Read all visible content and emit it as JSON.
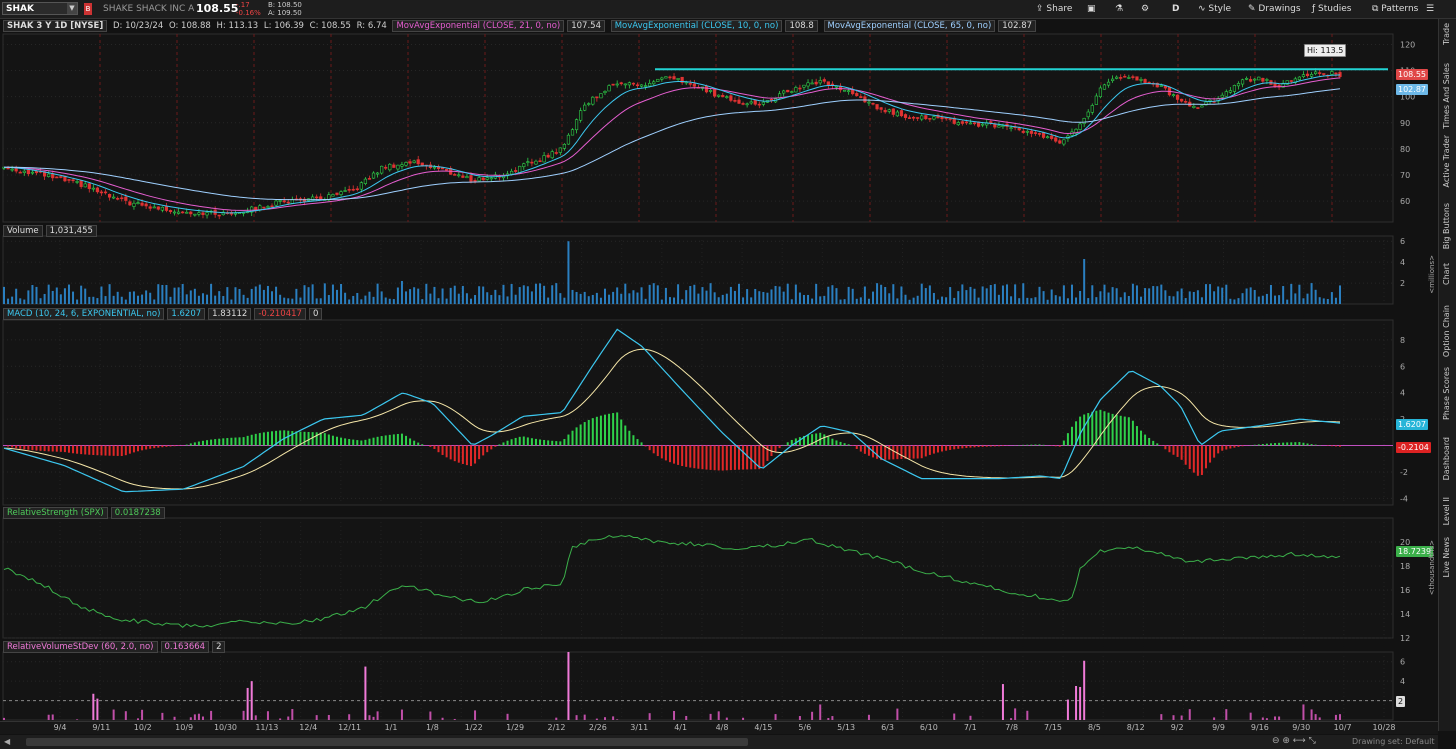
{
  "toolbar": {
    "symbol": "SHAK",
    "company": "SHAKE SHACK INC A",
    "last": "108.55",
    "change": "-.17",
    "change_pct": "-0.16%",
    "bid": "B: 108.50",
    "ask": "A: 109.50",
    "share": "Share",
    "timeframe": "D",
    "style": "Style",
    "drawings": "Drawings",
    "studies": "Studies",
    "patterns": "Patterns"
  },
  "header": {
    "title": "SHAK 3 Y 1D [NYSE]",
    "date": "D: 10/23/24",
    "open": "O: 108.88",
    "high": "H: 113.13",
    "low": "L: 106.39",
    "close": "C: 108.55",
    "range": "R: 6.74",
    "ema21": "MovAvgExponential (CLOSE, 21, 0, no)",
    "ema21_val": "107.54",
    "ema10": "MovAvgExponential (CLOSE, 10, 0, no)",
    "ema10_val": "108.8",
    "ema65": "MovAvgExponential (CLOSE, 65, 0, no)",
    "ema65_val": "102.87"
  },
  "volume": {
    "label": "Volume",
    "value": "1,031,455",
    "unit": "<millions>"
  },
  "macd": {
    "label": "MACD (10, 24, 6, EXPONENTIAL, no)",
    "v1": "1.6207",
    "v2": "1.83112",
    "v3": "-0.210417",
    "v4": "0"
  },
  "rs": {
    "label": "RelativeStrength (SPX)",
    "value": "0.0187238",
    "unit": "<thousandths>"
  },
  "rvol": {
    "label": "RelativeVolumeStDev (60, 2.0, no)",
    "value": "0.163664",
    "v2": "2"
  },
  "price_labels": {
    "hi": "Hi: 113.5",
    "last": "108.55",
    "ema65": "102.87",
    "macd": "1.6207",
    "macd_hist": "-0.2104",
    "rs": "18.7239",
    "rvol": "2"
  },
  "side_tabs": [
    "Trade",
    "Times And Sales",
    "Active Trader",
    "Big Buttons",
    "Chart",
    "Option Chain",
    "Phase Scores",
    "Dashboard",
    "Level II",
    "Live News"
  ],
  "footer": {
    "drawing_set": "Drawing set: Default"
  },
  "chart_data": {
    "type": "candlestick",
    "price_axis": {
      "ticks": [
        60,
        70,
        80,
        90,
        100,
        110,
        120
      ],
      "ylim": [
        52,
        124
      ]
    },
    "volume_axis": {
      "ticks": [
        2,
        4,
        6
      ],
      "ylim": [
        0,
        6.5
      ]
    },
    "macd_axis": {
      "ticks": [
        -4,
        -2,
        2,
        4,
        6,
        8
      ],
      "ylim": [
        -4.5,
        9.5
      ]
    },
    "rs_axis": {
      "ticks": [
        12,
        14,
        16,
        18,
        20
      ],
      "ylim": [
        12,
        22
      ]
    },
    "rvol_axis": {
      "ticks": [
        2,
        4,
        6
      ],
      "ylim": [
        0,
        7
      ]
    },
    "x_ticks": [
      "9/4",
      "9/11",
      "10/2",
      "10/9",
      "10/30",
      "11/13",
      "12/4",
      "12/11",
      "1/1",
      "1/8",
      "1/22",
      "1/29",
      "2/12",
      "2/26",
      "3/11",
      "4/1",
      "4/8",
      "4/15",
      "5/6",
      "5/13",
      "6/3",
      "6/10",
      "7/1",
      "7/8",
      "7/15",
      "8/5",
      "8/12",
      "9/2",
      "9/9",
      "9/16",
      "9/30",
      "10/7",
      "10/28"
    ],
    "close_path": [
      [
        0,
        73
      ],
      [
        40,
        70
      ],
      [
        80,
        66
      ],
      [
        110,
        61
      ],
      [
        140,
        58
      ],
      [
        180,
        56
      ],
      [
        220,
        55
      ],
      [
        250,
        57
      ],
      [
        280,
        60
      ],
      [
        320,
        61
      ],
      [
        350,
        64
      ],
      [
        380,
        73
      ],
      [
        410,
        75
      ],
      [
        440,
        72
      ],
      [
        470,
        68
      ],
      [
        500,
        70
      ],
      [
        530,
        75
      ],
      [
        560,
        80
      ],
      [
        580,
        96
      ],
      [
        600,
        102
      ],
      [
        620,
        106
      ],
      [
        640,
        104
      ],
      [
        660,
        107
      ],
      [
        680,
        106
      ],
      [
        700,
        103
      ],
      [
        720,
        100
      ],
      [
        740,
        98
      ],
      [
        760,
        97
      ],
      [
        780,
        101
      ],
      [
        800,
        104
      ],
      [
        820,
        106
      ],
      [
        840,
        103
      ],
      [
        860,
        99
      ],
      [
        880,
        95
      ],
      [
        900,
        93
      ],
      [
        930,
        92
      ],
      [
        960,
        90
      ],
      [
        990,
        89
      ],
      [
        1020,
        87
      ],
      [
        1040,
        85
      ],
      [
        1060,
        82
      ],
      [
        1080,
        90
      ],
      [
        1100,
        103
      ],
      [
        1120,
        108
      ],
      [
        1140,
        106
      ],
      [
        1160,
        104
      ],
      [
        1180,
        98
      ],
      [
        1200,
        96
      ],
      [
        1220,
        100
      ],
      [
        1240,
        106
      ],
      [
        1260,
        107
      ],
      [
        1280,
        104
      ],
      [
        1300,
        108
      ],
      [
        1320,
        109
      ],
      [
        1340,
        108.55
      ]
    ],
    "resistance": 110.5,
    "macd_line": [
      [
        0,
        -0.2
      ],
      [
        60,
        -1.5
      ],
      [
        120,
        -3.5
      ],
      [
        180,
        -3.3
      ],
      [
        240,
        -1.6
      ],
      [
        280,
        0.5
      ],
      [
        320,
        2
      ],
      [
        360,
        2.3
      ],
      [
        400,
        4
      ],
      [
        430,
        3.2
      ],
      [
        470,
        0
      ],
      [
        490,
        0.8
      ],
      [
        520,
        2.2
      ],
      [
        560,
        2.5
      ],
      [
        590,
        6
      ],
      [
        615,
        8.8
      ],
      [
        640,
        7.5
      ],
      [
        680,
        4.2
      ],
      [
        720,
        1
      ],
      [
        760,
        -1.8
      ],
      [
        790,
        0
      ],
      [
        820,
        1.5
      ],
      [
        850,
        1
      ],
      [
        880,
        -1
      ],
      [
        920,
        -2.5
      ],
      [
        960,
        -2.5
      ],
      [
        1000,
        -2.5
      ],
      [
        1040,
        -2.3
      ],
      [
        1060,
        -2.5
      ],
      [
        1080,
        1
      ],
      [
        1100,
        3.5
      ],
      [
        1130,
        5.7
      ],
      [
        1160,
        4.5
      ],
      [
        1180,
        3
      ],
      [
        1200,
        0
      ],
      [
        1220,
        1.1
      ],
      [
        1260,
        1.5
      ],
      [
        1300,
        2
      ],
      [
        1340,
        1.7
      ]
    ],
    "rs_line": [
      [
        0,
        17.8
      ],
      [
        40,
        16.4
      ],
      [
        80,
        14.5
      ],
      [
        120,
        13.5
      ],
      [
        160,
        13.2
      ],
      [
        200,
        12.9
      ],
      [
        240,
        13.4
      ],
      [
        280,
        13.2
      ],
      [
        320,
        13.6
      ],
      [
        360,
        14.5
      ],
      [
        400,
        16.5
      ],
      [
        440,
        15.5
      ],
      [
        480,
        15
      ],
      [
        520,
        16
      ],
      [
        560,
        16.5
      ],
      [
        570,
        19.6
      ],
      [
        600,
        20.4
      ],
      [
        620,
        20.5
      ],
      [
        660,
        20
      ],
      [
        700,
        19.8
      ],
      [
        740,
        19.4
      ],
      [
        780,
        19.8
      ],
      [
        810,
        20.2
      ],
      [
        840,
        19.4
      ],
      [
        880,
        18.6
      ],
      [
        920,
        17.6
      ],
      [
        960,
        16.8
      ],
      [
        1000,
        16
      ],
      [
        1040,
        15.4
      ],
      [
        1070,
        15
      ],
      [
        1080,
        18
      ],
      [
        1100,
        19.2
      ],
      [
        1130,
        19.6
      ],
      [
        1160,
        19.1
      ],
      [
        1190,
        18.3
      ],
      [
        1220,
        18.5
      ],
      [
        1260,
        18.8
      ],
      [
        1300,
        19
      ],
      [
        1340,
        18.7
      ]
    ]
  }
}
